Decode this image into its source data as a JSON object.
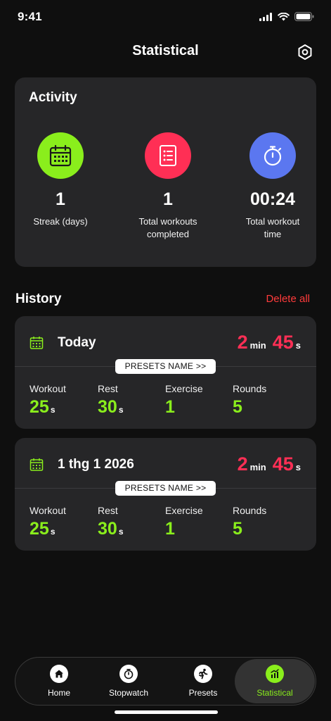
{
  "status_bar": {
    "time": "9:41"
  },
  "header": {
    "title": "Statistical",
    "settings_icon": "settings-hex-icon"
  },
  "activity": {
    "title": "Activity",
    "stats": [
      {
        "value": "1",
        "label": "Streak (days)",
        "icon": "calendar-icon",
        "color": "#8aee1c"
      },
      {
        "value": "1",
        "label": "Total workouts completed",
        "icon": "checklist-icon",
        "color": "#ff2f55"
      },
      {
        "value": "00:24",
        "label": "Total workout time",
        "icon": "stopwatch-icon",
        "color": "#5b77f0"
      }
    ]
  },
  "history": {
    "title": "History",
    "delete_all": "Delete all",
    "sessions": [
      {
        "date": "Today",
        "duration_min": "2",
        "min_unit": "min",
        "duration_sec": "45",
        "sec_unit": "s",
        "preset": "PRESETS NAME >>",
        "workout_label": "Workout",
        "workout_value": "25",
        "workout_unit": "s",
        "rest_label": "Rest",
        "rest_value": "30",
        "rest_unit": "s",
        "exercise_label": "Exercise",
        "exercise_value": "1",
        "rounds_label": "Rounds",
        "rounds_value": "5"
      },
      {
        "date": "1 thg 1 2026",
        "duration_min": "2",
        "min_unit": "min",
        "duration_sec": "45",
        "sec_unit": "s",
        "preset": "PRESETS NAME >>",
        "workout_label": "Workout",
        "workout_value": "25",
        "workout_unit": "s",
        "rest_label": "Rest",
        "rest_value": "30",
        "rest_unit": "s",
        "exercise_label": "Exercise",
        "exercise_value": "1",
        "rounds_label": "Rounds",
        "rounds_value": "5"
      }
    ]
  },
  "tabs": [
    {
      "label": "Home",
      "icon": "home-icon"
    },
    {
      "label": "Stopwatch",
      "icon": "stopwatch-icon"
    },
    {
      "label": "Presets",
      "icon": "running-icon"
    },
    {
      "label": "Statistical",
      "icon": "chart-icon",
      "active": true
    }
  ],
  "colors": {
    "accent_green": "#8aee1c",
    "accent_red": "#ff2f55",
    "accent_blue": "#5b77f0",
    "delete_red": "#ff3b3b",
    "card": "#262628",
    "background": "#0f0f0f"
  }
}
